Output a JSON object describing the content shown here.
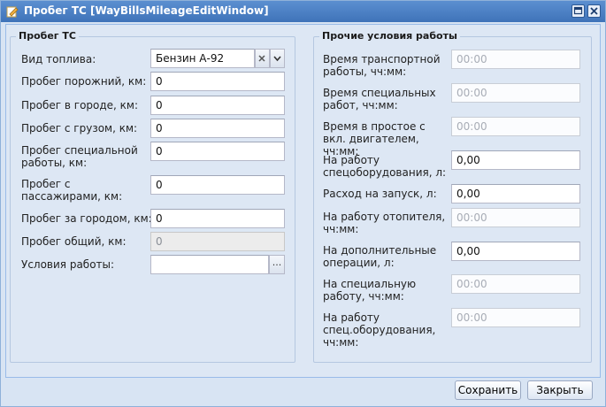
{
  "window": {
    "title": "Пробег ТС [WayBillsMileageEditWindow]"
  },
  "left_panel": {
    "legend": "Пробег ТС",
    "fuel_type": {
      "label": "Вид топлива:",
      "value": "Бензин  А-92"
    },
    "fields": [
      {
        "label": "Пробег порожний, км:",
        "value": "0"
      },
      {
        "label": "Пробег в городе, км:",
        "value": "0"
      },
      {
        "label": "Пробег с грузом, км:",
        "value": "0"
      },
      {
        "label": "Пробег специальной работы, км:",
        "value": "0"
      },
      {
        "label": "Пробег с пассажирами, км:",
        "value": "0"
      },
      {
        "label": "Пробег за городом, км:",
        "value": "0"
      },
      {
        "label": "Пробег общий, км:",
        "value": "0"
      }
    ],
    "conditions": {
      "label": "Условия работы:",
      "value": "",
      "button": "..."
    }
  },
  "right_panel": {
    "legend": "Прочие условия работы",
    "fields": [
      {
        "label": "Время транспортной работы, чч:мм:",
        "value": "00:00"
      },
      {
        "label": "Время специальных работ, чч:мм:",
        "value": "00:00"
      },
      {
        "label": "Время в простое с вкл. двигателем, чч:мм:",
        "value": "00:00"
      },
      {
        "label": "На работу спецоборудования, л:",
        "value": "0,00"
      },
      {
        "label": "Расход на запуск, л:",
        "value": "0,00"
      },
      {
        "label": "На работу отопителя, чч:мм:",
        "value": "00:00"
      },
      {
        "label": "На дополнительные операции, л:",
        "value": "0,00"
      },
      {
        "label": "На специальную работу, чч:мм:",
        "value": "00:00"
      },
      {
        "label": "На работу спец.оборудования, чч:мм:",
        "value": "00:00"
      }
    ]
  },
  "footer": {
    "save": "Сохранить",
    "close": "Закрыть"
  }
}
